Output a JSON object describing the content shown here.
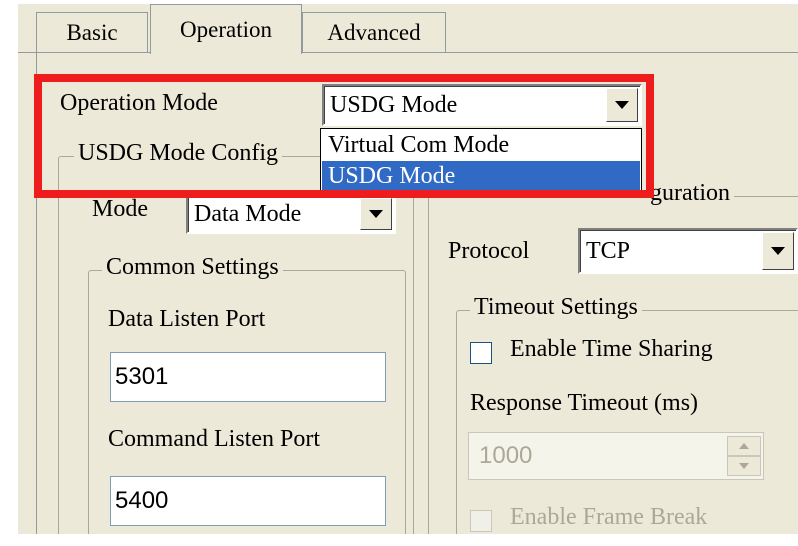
{
  "tabs": {
    "basic": "Basic",
    "operation": "Operation",
    "advanced": "Advanced"
  },
  "operation_mode": {
    "label": "Operation Mode",
    "selected": "USDG Mode",
    "options": [
      "Virtual Com Mode",
      "USDG Mode"
    ],
    "highlighted_option": "USDG Mode"
  },
  "usdg_group": {
    "title_visible": "USDG Mode Config",
    "mode_label": "Mode",
    "mode_value": "Data Mode"
  },
  "common_settings": {
    "title": "Common Settings",
    "data_listen_port_label": "Data Listen Port",
    "data_listen_port_value": "5301",
    "command_listen_port_label": "Command Listen Port",
    "command_listen_port_value": "5400"
  },
  "connection_group": {
    "title_visible": "guration",
    "protocol_label": "Protocol",
    "protocol_value": "TCP"
  },
  "timeout_settings": {
    "title": "Timeout Settings",
    "enable_time_sharing_label": "Enable Time Sharing",
    "enable_time_sharing_checked": false,
    "response_timeout_label": "Response Timeout (ms)",
    "response_timeout_value": "1000",
    "enable_frame_break_label": "Enable Frame Break",
    "enable_frame_break_checked": false
  },
  "colors": {
    "highlight_red": "#ee1c1c",
    "selection_blue": "#316ac5",
    "dialog_bg": "#ece9d8"
  }
}
